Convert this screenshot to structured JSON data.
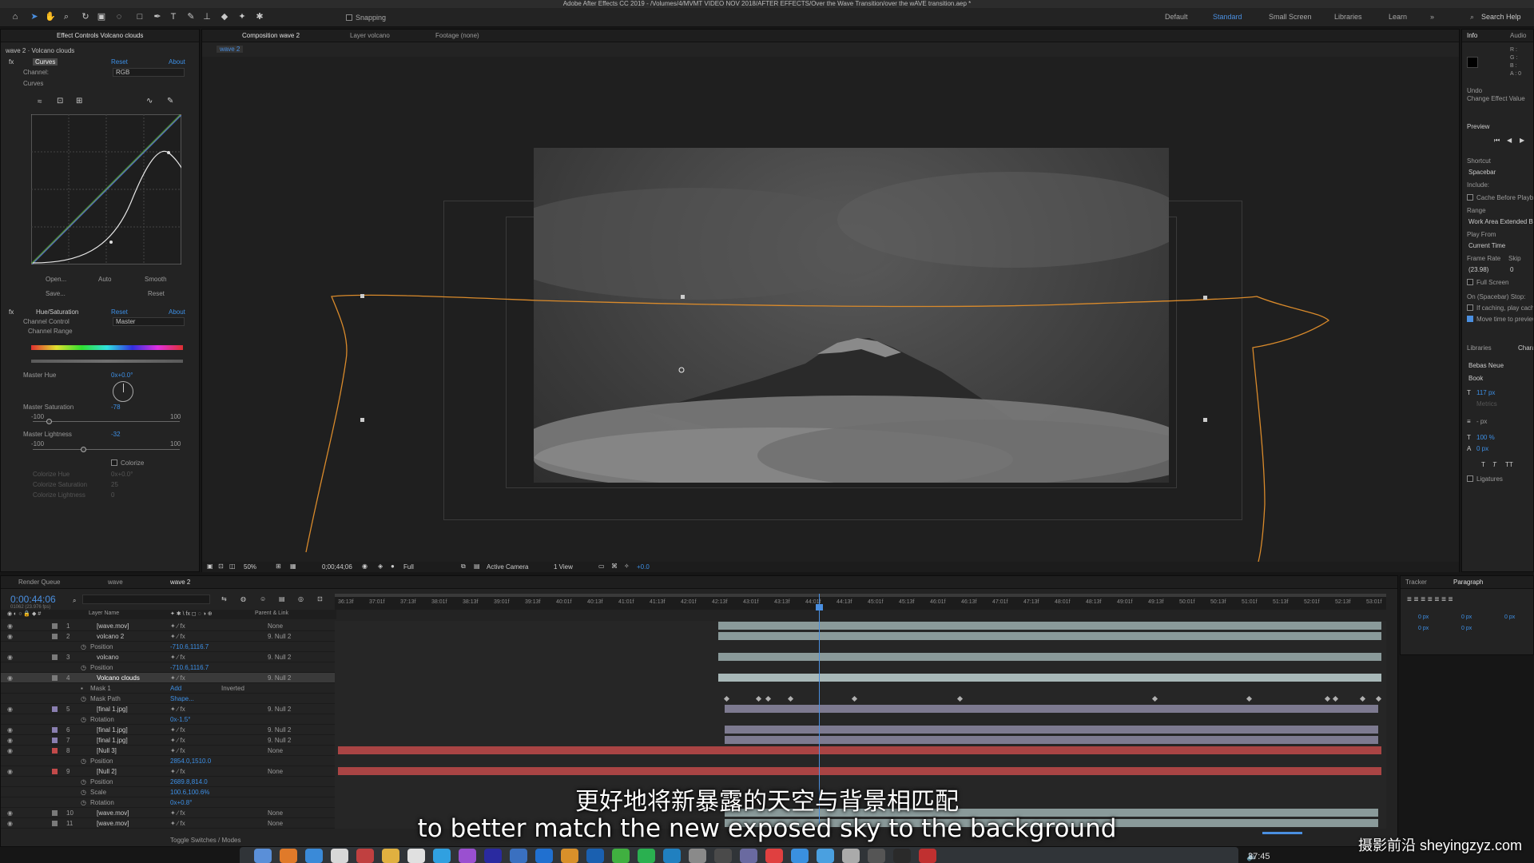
{
  "window": {
    "title": "Adobe After Effects CC 2019 - /Volumes/4/MVMT VIDEO NOV 2018/AFTER EFFECTS/Over the Wave Transition/over the wAVE transition.aep *"
  },
  "toolbar": {
    "snapping_label": "Snapping",
    "workspaces": [
      "Default",
      "Standard",
      "Small Screen",
      "Libraries",
      "Learn"
    ],
    "active_workspace": "Standard",
    "search_help": "Search Help",
    "tools": [
      "home-icon",
      "selection-tool-icon",
      "hand-tool-icon",
      "zoom-tool-icon",
      "rotate-tool-icon",
      "camera-tool-icon",
      "pan-behind-icon",
      "rectangle-tool-icon",
      "pen-tool-icon",
      "type-tool-icon",
      "brush-tool-icon",
      "clone-stamp-icon",
      "eraser-icon",
      "roto-brush-icon",
      "puppet-pin-icon"
    ]
  },
  "effect_controls": {
    "tabs": [
      "Effect Controls Volcano clouds"
    ],
    "layer_path": "wave 2 · Volcano clouds",
    "curves": {
      "name": "Curves",
      "reset": "Reset",
      "about": "About",
      "channel_label": "Channel:",
      "channel_value": "RGB",
      "curves_label": "Curves",
      "buttons": [
        "Open...",
        "Auto",
        "Smooth",
        "Save...",
        "Reset"
      ]
    },
    "hue_sat": {
      "name": "Hue/Saturation",
      "reset": "Reset",
      "about": "About",
      "channel_control_label": "Channel Control",
      "channel_control_value": "Master",
      "channel_range_label": "Channel Range",
      "master_hue_label": "Master Hue",
      "master_hue_value": "0x+0.0°",
      "master_saturation_label": "Master Saturation",
      "master_saturation_value": "-78",
      "master_lightness_label": "Master Lightness",
      "master_lightness_value": "-32",
      "min": "-100",
      "max": "100",
      "saturation_fraction": 0.11,
      "lightness_fraction": 0.34,
      "colorize_label": "Colorize",
      "colorize_hue_label": "Colorize Hue",
      "colorize_hue_value": "0x+0.0°",
      "colorize_saturation_label": "Colorize Saturation",
      "colorize_saturation_value": "25",
      "colorize_lightness_label": "Colorize Lightness",
      "colorize_lightness_value": "0"
    }
  },
  "composition": {
    "tabs": [
      "Composition wave 2",
      "Layer volcano",
      "Footage (none)"
    ],
    "breadcrumb": "wave 2",
    "footer": {
      "zoom": "50%",
      "timecode": "0;00;44;06",
      "resolution": "Full",
      "camera": "Active Camera",
      "views": "1 View",
      "exposure": "+0.0"
    }
  },
  "info_panel": {
    "tabs": [
      "Info",
      "Audio"
    ],
    "rgb": [
      "R :",
      "G :",
      "B :",
      "A : 0"
    ],
    "undo_label": "Undo",
    "undo_value": "Change Effect Value",
    "preview_tab": "Preview",
    "shortcut_label": "Shortcut",
    "shortcut_value": "Spacebar",
    "include_label": "Include:",
    "cache_label": "Cache Before Playback",
    "range_label": "Range",
    "range_value": "Work Area Extended By",
    "play_from_label": "Play From",
    "play_from_value": "Current Time",
    "frame_rate_label": "Frame Rate",
    "skip_label": "Skip",
    "frame_rate_value": "(23.98)",
    "skip_value": "0",
    "full_screen_label": "Full Screen",
    "on_stop_label": "On (Spacebar) Stop:",
    "if_caching_label": "If caching, play cached",
    "move_time_label": "Move time to preview time",
    "libraries_tab": "Libraries",
    "character_tab": "Chara",
    "font": "Bebas Neue",
    "style": "Book",
    "font_size": "117 px",
    "kerning": "Metrics",
    "leading": "- px",
    "vertical_scale": "100 %",
    "baseline": "0 px",
    "ligatures": "Ligatures"
  },
  "timeline": {
    "tabs": [
      "Render Queue",
      "wave",
      "wave 2"
    ],
    "timecode": "0:00:44:06",
    "subcode": "01062 (23.976 fps)",
    "columns": {
      "layer_name": "Layer Name",
      "parent": "Parent & Link"
    },
    "ticks": [
      "36:13f",
      "37:01f",
      "37:13f",
      "38:01f",
      "38:13f",
      "39:01f",
      "39:13f",
      "40:01f",
      "40:13f",
      "41:01f",
      "41:13f",
      "42:01f",
      "42:13f",
      "43:01f",
      "43:13f",
      "44:01f",
      "44:13f",
      "45:01f",
      "45:13f",
      "46:01f",
      "46:13f",
      "47:01f",
      "47:13f",
      "48:01f",
      "48:13f",
      "49:01f",
      "49:13f",
      "50:01f",
      "50:13f",
      "51:01f",
      "51:13f",
      "52:01f",
      "52:13f",
      "53:01f"
    ],
    "rows": [
      {
        "num": "1",
        "name": "[wave.mov]",
        "parent": "None",
        "color": "#7a7a7a",
        "kind": "layer"
      },
      {
        "num": "2",
        "name": "volcano 2",
        "parent": "9. Null 2",
        "color": "#7a7a7a",
        "kind": "layer"
      },
      {
        "num": "",
        "name": "Position",
        "value": "-710.6,1116.7",
        "kind": "prop"
      },
      {
        "num": "3",
        "name": "volcano",
        "parent": "9. Null 2",
        "color": "#7a7a7a",
        "kind": "layer"
      },
      {
        "num": "",
        "name": "Position",
        "value": "-710.6,1116.7",
        "kind": "prop"
      },
      {
        "num": "4",
        "name": "Volcano clouds",
        "parent": "9. Null 2",
        "color": "#7a7a7a",
        "kind": "layer",
        "selected": true
      },
      {
        "num": "",
        "name": "Mask 1",
        "value": "Add",
        "extra": "Inverted",
        "kind": "mask"
      },
      {
        "num": "",
        "name": "Mask Path",
        "value": "Shape...",
        "kind": "prop"
      },
      {
        "num": "5",
        "name": "[final 1.jpg]",
        "parent": "9. Null 2",
        "color": "#8a7fb0",
        "kind": "layer"
      },
      {
        "num": "",
        "name": "Rotation",
        "value": "0x-1.5°",
        "kind": "prop"
      },
      {
        "num": "6",
        "name": "[final 1.jpg]",
        "parent": "9. Null 2",
        "color": "#8a7fb0",
        "kind": "layer"
      },
      {
        "num": "7",
        "name": "[final 1.jpg]",
        "parent": "9. Null 2",
        "color": "#8a7fb0",
        "kind": "layer"
      },
      {
        "num": "8",
        "name": "[Null 3]",
        "parent": "None",
        "color": "#c24a4a",
        "kind": "layer"
      },
      {
        "num": "",
        "name": "Position",
        "value": "2854.0,1510.0",
        "kind": "prop"
      },
      {
        "num": "9",
        "name": "[Null 2]",
        "parent": "None",
        "color": "#c24a4a",
        "kind": "layer"
      },
      {
        "num": "",
        "name": "Position",
        "value": "2689.8,814.0",
        "kind": "prop"
      },
      {
        "num": "",
        "name": "Scale",
        "value": "100.6,100.6%",
        "kind": "prop"
      },
      {
        "num": "",
        "name": "Rotation",
        "value": "0x+0.8°",
        "kind": "prop"
      },
      {
        "num": "10",
        "name": "[wave.mov]",
        "parent": "None",
        "color": "#7a7a7a",
        "kind": "layer"
      },
      {
        "num": "11",
        "name": "[wave.mov]",
        "parent": "None",
        "color": "#7a7a7a",
        "kind": "layer"
      }
    ],
    "toggle_label": "Toggle Switches / Modes"
  },
  "paragraph_panel": {
    "tabs": [
      "Tracker",
      "Paragraph"
    ],
    "values": [
      "0 px",
      "0 px",
      "0 px",
      "0 px",
      "0 px"
    ]
  },
  "subtitles": {
    "chinese": "更好地将新暴露的天空与背景相匹配",
    "english": "to better match the new exposed sky to the background"
  },
  "watermark": "摄影前沿 sheyingzyz.com",
  "clock": "37:45",
  "colors": {
    "accent": "#4a8fe0",
    "path": "#d98a2b",
    "bar": "#8a9a9a",
    "null_bar": "#a94444"
  }
}
